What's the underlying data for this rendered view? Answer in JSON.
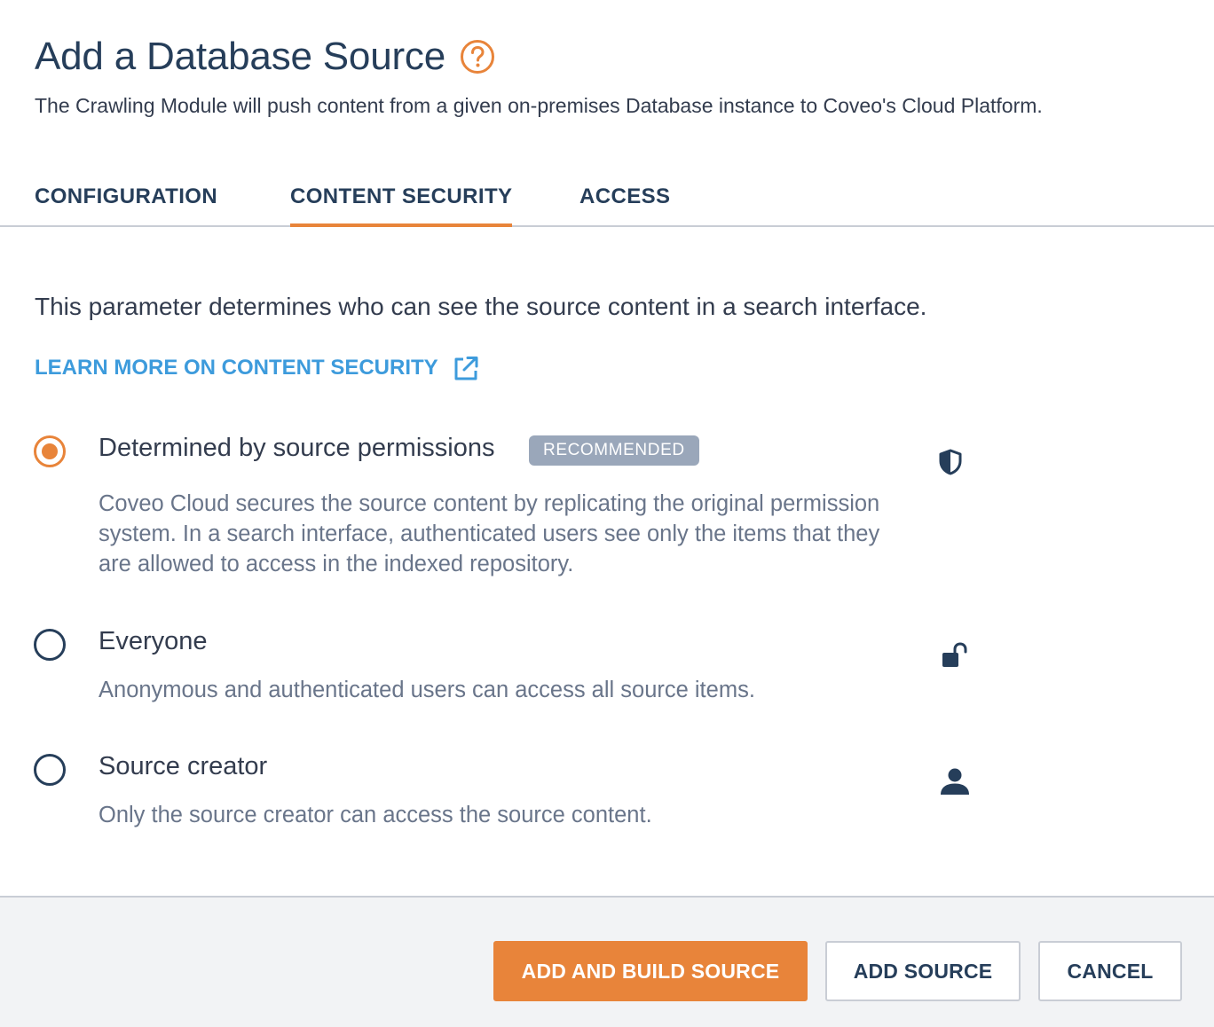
{
  "header": {
    "title": "Add a Database Source",
    "help_icon": "question-circle-icon",
    "subtitle": "The Crawling Module will push content from a given on-premises Database instance to Coveo's Cloud Platform."
  },
  "tabs": [
    {
      "label": "CONFIGURATION",
      "active": false
    },
    {
      "label": "CONTENT SECURITY",
      "active": true
    },
    {
      "label": "ACCESS",
      "active": false
    }
  ],
  "content": {
    "intro": "This parameter determines who can see the source content in a search interface.",
    "learn_more_label": "LEARN MORE ON CONTENT SECURITY",
    "learn_more_icon": "external-link-icon",
    "options": [
      {
        "label": "Determined by source permissions",
        "badge": "RECOMMENDED",
        "description": "Coveo Cloud secures the source content by replicating the original permission system. In a search interface, authenticated users see only the items that they are allowed to access in the indexed repository.",
        "selected": true,
        "icon": "shield-icon"
      },
      {
        "label": "Everyone",
        "description": "Anonymous and authenticated users can access all source items.",
        "selected": false,
        "icon": "unlock-icon"
      },
      {
        "label": "Source creator",
        "description": "Only the source creator can access the source content.",
        "selected": false,
        "icon": "user-icon"
      }
    ]
  },
  "footer": {
    "add_and_build_label": "ADD AND BUILD SOURCE",
    "add_source_label": "ADD SOURCE",
    "cancel_label": "CANCEL"
  },
  "colors": {
    "accent": "#e8843a",
    "heading": "#263e5a",
    "link": "#3d9bdc",
    "badge_bg": "#9aa7ba",
    "muted_text": "#69758a"
  }
}
